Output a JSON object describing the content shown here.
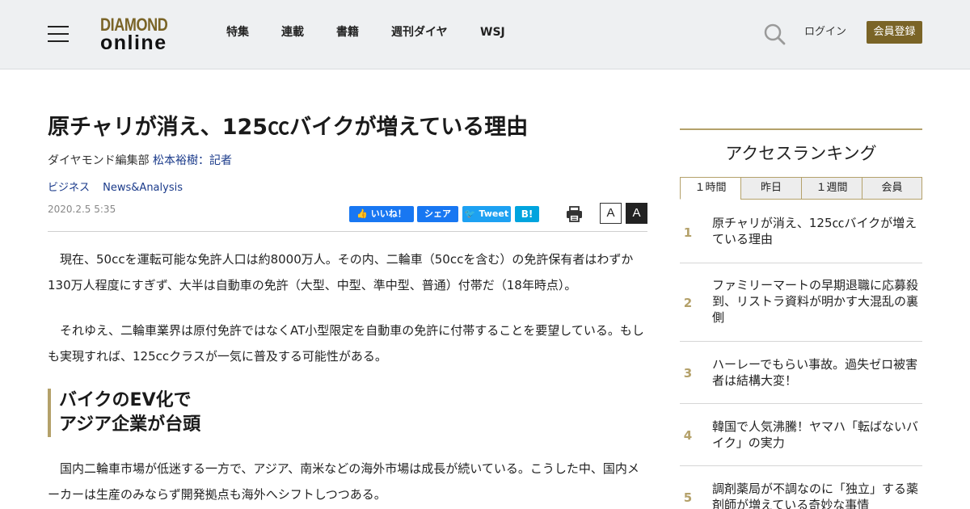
{
  "header": {
    "logo_top": "DIAMOND",
    "logo_bottom": "online",
    "nav": [
      "特集",
      "連載",
      "書籍",
      "週刊ダイヤ",
      "WSJ"
    ],
    "login_label": "ログイン",
    "register_label": "会員登録"
  },
  "article": {
    "title": "原チャリが消え、125㏄バイクが増えている理由",
    "author_prefix": "ダイヤモンド編集部 ",
    "author_link": "松本裕樹：記者",
    "tags": [
      "ビジネス",
      "News&Analysis"
    ],
    "date": "2020.2.5 5:35",
    "share": {
      "fb_like": "いいね！",
      "fb_share": "シェア",
      "tweet": "Tweet",
      "hatena": "B!"
    },
    "font_small": "A",
    "font_large": "A",
    "paragraphs": [
      "　現在、50ccを運転可能な免許人口は約8000万人。その内、二輪車（50ccを含む）の免許保有者はわずか130万人程度にすぎず、大半は自動車の免許（大型、中型、準中型、普通）付帯だ（18年時点）。",
      "　それゆえ、二輪車業界は原付免許ではなくAT小型限定を自動車の免許に付帯することを要望している。もしも実現すれば、125ccクラスが一気に普及する可能性がある。",
      "　国内二輪車市場が低迷する一方で、アジア、南米などの海外市場は成長が続いている。こうした中、国内メーカーは生産のみならず開発拠点も海外へシフトしつつある。"
    ],
    "subheading_line1": "バイクのEV化で",
    "subheading_line2": "アジア企業が台頭"
  },
  "ranking": {
    "title": "アクセスランキング",
    "tabs": [
      "１時間",
      "昨日",
      "１週間",
      "会員"
    ],
    "active_tab": 0,
    "items": [
      {
        "rank": "1",
        "text": "原チャリが消え、125㏄バイクが増えている理由"
      },
      {
        "rank": "2",
        "text": "ファミリーマートの早期退職に応募殺到、リストラ資料が明かす大混乱の裏側"
      },
      {
        "rank": "3",
        "text": "ハーレーでもらい事故。過失ゼロ被害者は結構大変！"
      },
      {
        "rank": "4",
        "text": "韓国で人気沸騰！ヤマハ「転ばないバイク」の実力"
      },
      {
        "rank": "5",
        "text": "調剤薬局が不調なのに「独立」する薬剤師が増えている奇妙な事情"
      }
    ]
  },
  "colors": {
    "accent_gold": "#b4a16a",
    "logo_gold": "#7a6427",
    "link_blue": "#1a3a8a",
    "facebook": "#1877f2",
    "twitter": "#1da1f2",
    "hatena": "#00a4de"
  },
  "icons": [
    "hamburger-icon",
    "search-icon",
    "print-icon"
  ]
}
